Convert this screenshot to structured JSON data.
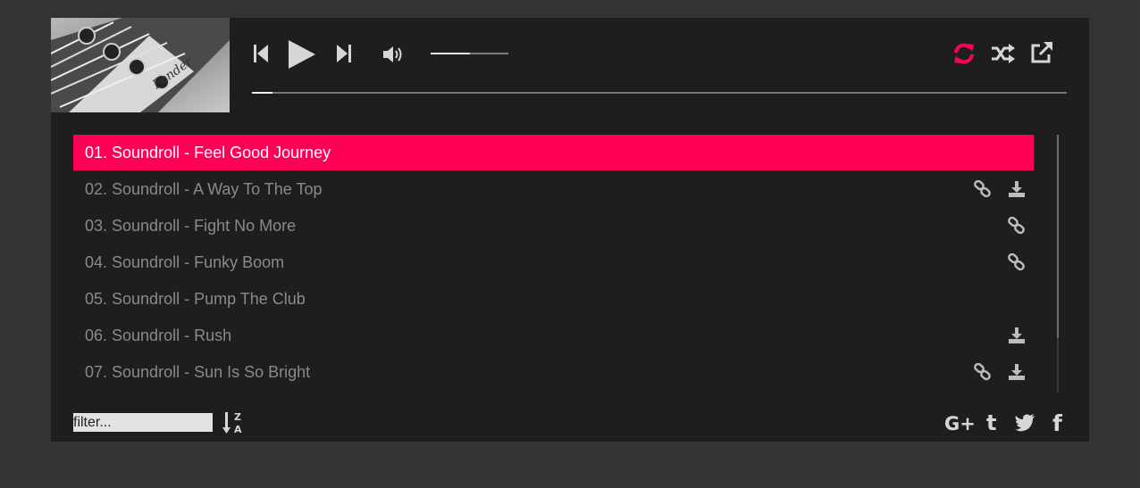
{
  "colors": {
    "accent": "#ff0055",
    "panel": "#1e1e1e",
    "page": "#333333",
    "icon": "#d6d6d6",
    "muted_text": "#8a8a8a"
  },
  "cover": {
    "icon": "guitar-headstock-photo",
    "logo_text": "Fender"
  },
  "controls": {
    "previous_icon": "step-backward-icon",
    "play_icon": "play-icon",
    "next_icon": "step-forward-icon",
    "volume_icon": "volume-up-icon",
    "repeat_icon": "refresh-icon",
    "shuffle_icon": "random-icon",
    "popout_icon": "external-link-icon",
    "volume_level": 0.5,
    "progress": 0.025
  },
  "playlist": {
    "tracks": [
      {
        "title": "01. Soundroll - Feel Good Journey",
        "active": true,
        "link": false,
        "download": false
      },
      {
        "title": "02. Soundroll - A Way To The Top",
        "active": false,
        "link": true,
        "download": true
      },
      {
        "title": "03. Soundroll - Fight No More",
        "active": false,
        "link": true,
        "download": false
      },
      {
        "title": "04. Soundroll - Funky Boom",
        "active": false,
        "link": true,
        "download": false
      },
      {
        "title": "05. Soundroll - Pump The Club",
        "active": false,
        "link": false,
        "download": false
      },
      {
        "title": "06. Soundroll - Rush",
        "active": false,
        "link": false,
        "download": true
      },
      {
        "title": "07. Soundroll - Sun Is So Bright",
        "active": false,
        "link": true,
        "download": true
      }
    ],
    "link_icon": "chain-link-icon",
    "download_icon": "download-icon"
  },
  "footer": {
    "filter_placeholder": "filter...",
    "filter_value": "",
    "sort_icon": "sort-alpha-desc-icon",
    "sort_label_top": "Z",
    "sort_label_bottom": "A",
    "share": [
      {
        "icon": "google-plus-icon",
        "label": "G+"
      },
      {
        "icon": "tumblr-icon",
        "label": "t"
      },
      {
        "icon": "twitter-icon",
        "label": ""
      },
      {
        "icon": "facebook-icon",
        "label": "f"
      }
    ]
  }
}
